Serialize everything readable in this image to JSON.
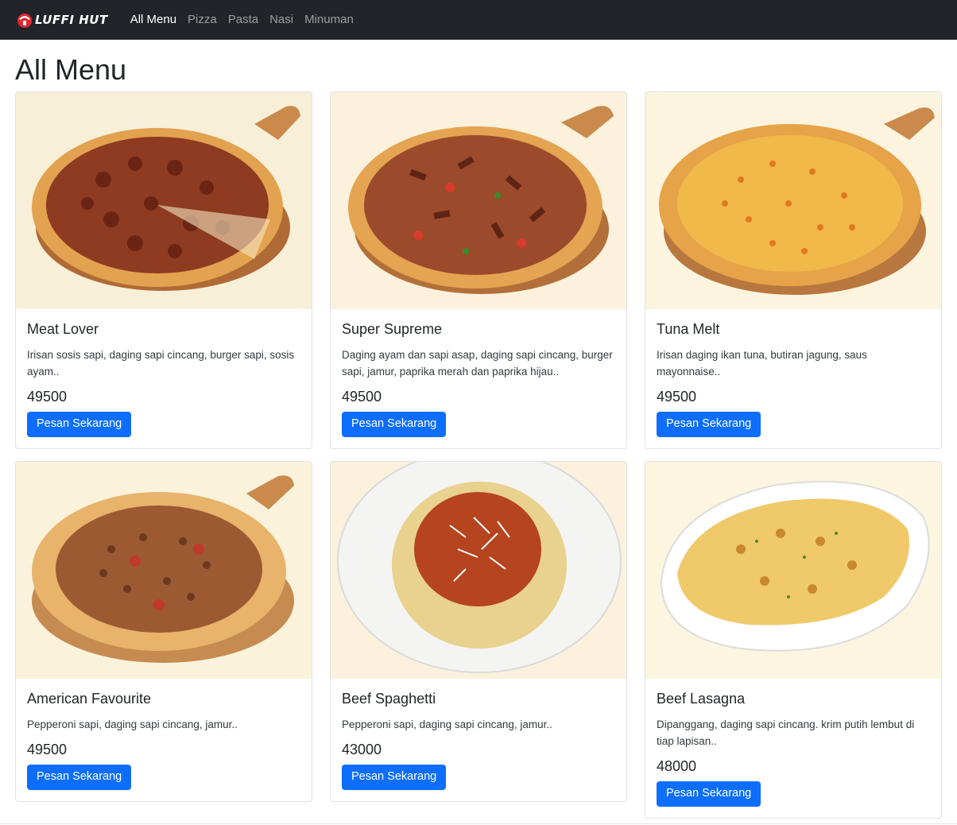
{
  "nav": {
    "brand": "LUFFI HUT",
    "links": [
      "All Menu",
      "Pizza",
      "Pasta",
      "Nasi",
      "Minuman"
    ],
    "active": "All Menu"
  },
  "page": {
    "title": "All Menu"
  },
  "menu": [
    {
      "name": "Meat Lover",
      "desc": "Irisan sosis sapi, daging sapi cincang, burger sapi, sosis ayam..",
      "price": "49500",
      "button": "Pesan Sekarang"
    },
    {
      "name": "Super Supreme",
      "desc": "Daging ayam dan sapi asap, daging sapi cincang, burger sapi, jamur, paprika merah dan paprika hijau..",
      "price": "49500",
      "button": "Pesan Sekarang"
    },
    {
      "name": "Tuna Melt",
      "desc": "Irisan daging ikan tuna, butiran jagung, saus mayonnaise..",
      "price": "49500",
      "button": "Pesan Sekarang"
    },
    {
      "name": "American Favourite",
      "desc": "Pepperoni sapi, daging sapi cincang, jamur..",
      "price": "49500",
      "button": "Pesan Sekarang"
    },
    {
      "name": "Beef Spaghetti",
      "desc": "Pepperoni sapi, daging sapi cincang, jamur..",
      "price": "43000",
      "button": "Pesan Sekarang"
    },
    {
      "name": "Beef Lasagna",
      "desc": "Dipanggang, daging sapi cincang. krim putih lembut di tiap lapisan..",
      "price": "48000",
      "button": "Pesan Sekarang"
    }
  ],
  "colors": {
    "navbar": "#212529",
    "primary": "#0d6efd",
    "image_bg": "#fdf6dc"
  }
}
